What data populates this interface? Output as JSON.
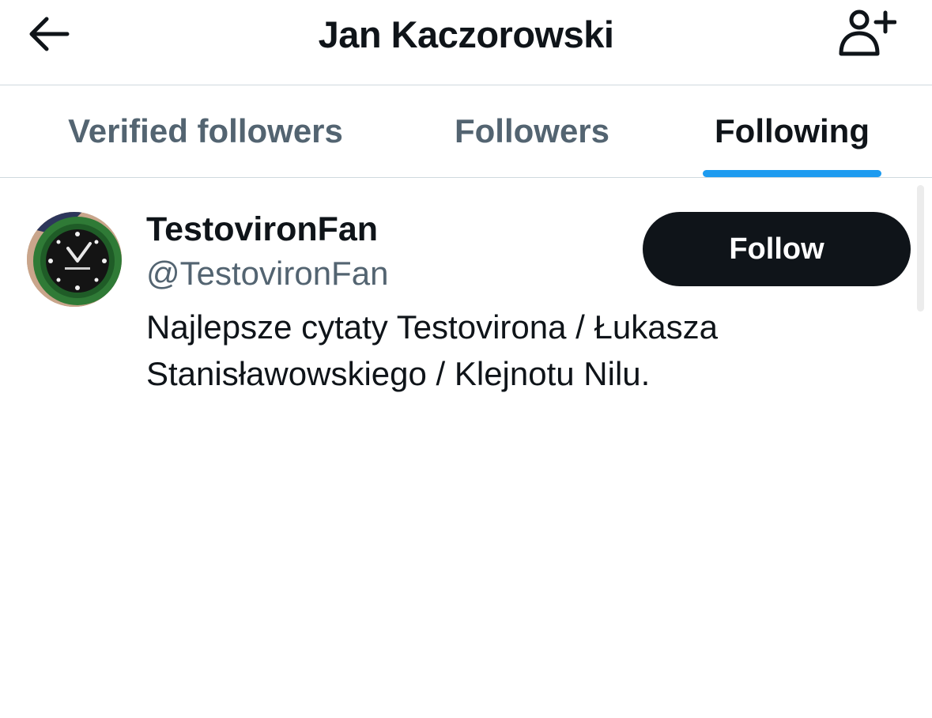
{
  "header": {
    "title": "Jan Kaczorowski",
    "back_icon": "arrow-left-icon",
    "add_user_icon": "person-add-icon"
  },
  "tabs": [
    {
      "label": "Verified followers",
      "active": false
    },
    {
      "label": "Followers",
      "active": false
    },
    {
      "label": "Following",
      "active": true
    }
  ],
  "users": [
    {
      "name": "TestovironFan",
      "handle": "@TestovironFan",
      "bio": "Najlepsze cytaty Testovirona / Łukasza Stanisławowskiego / Klejnotu Nilu.",
      "follow_label": "Follow",
      "avatar_icon": "wristwatch-avatar"
    }
  ],
  "colors": {
    "accent": "#1d9bf0",
    "text_primary": "#0f1419",
    "text_secondary": "#536471",
    "divider": "#cfd9de",
    "button_bg": "#0f1419",
    "button_text": "#ffffff"
  }
}
